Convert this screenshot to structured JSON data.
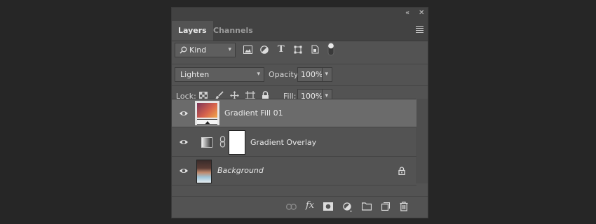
{
  "panel": {
    "collapse_icon": "«",
    "close_icon": "✕",
    "tabs": [
      {
        "label": "Layers",
        "active": true
      },
      {
        "label": "Channels",
        "active": false
      }
    ]
  },
  "filter": {
    "kind_label": "Kind",
    "icons": [
      "image-filter-icon",
      "adjustment-filter-icon",
      "type-filter-icon",
      "shape-filter-icon",
      "smart-object-filter-icon",
      "filter-toggle-icon"
    ]
  },
  "blend": {
    "mode": "Lighten",
    "opacity_label": "Opacity:",
    "opacity_value": "100%"
  },
  "lock": {
    "label": "Lock:",
    "fill_label": "Fill:",
    "fill_value": "100%"
  },
  "layers": [
    {
      "name": "Gradient Fill 01",
      "selected": true,
      "italic": false
    },
    {
      "name": "Gradient Overlay",
      "selected": false,
      "italic": false
    },
    {
      "name": "Background",
      "selected": false,
      "italic": true,
      "locked": true
    }
  ],
  "colors": {
    "panel_bg": "#535353",
    "selected_row": "#6b6b6b",
    "gradient_start": "#8a3a55",
    "gradient_end": "#f0a24a"
  }
}
